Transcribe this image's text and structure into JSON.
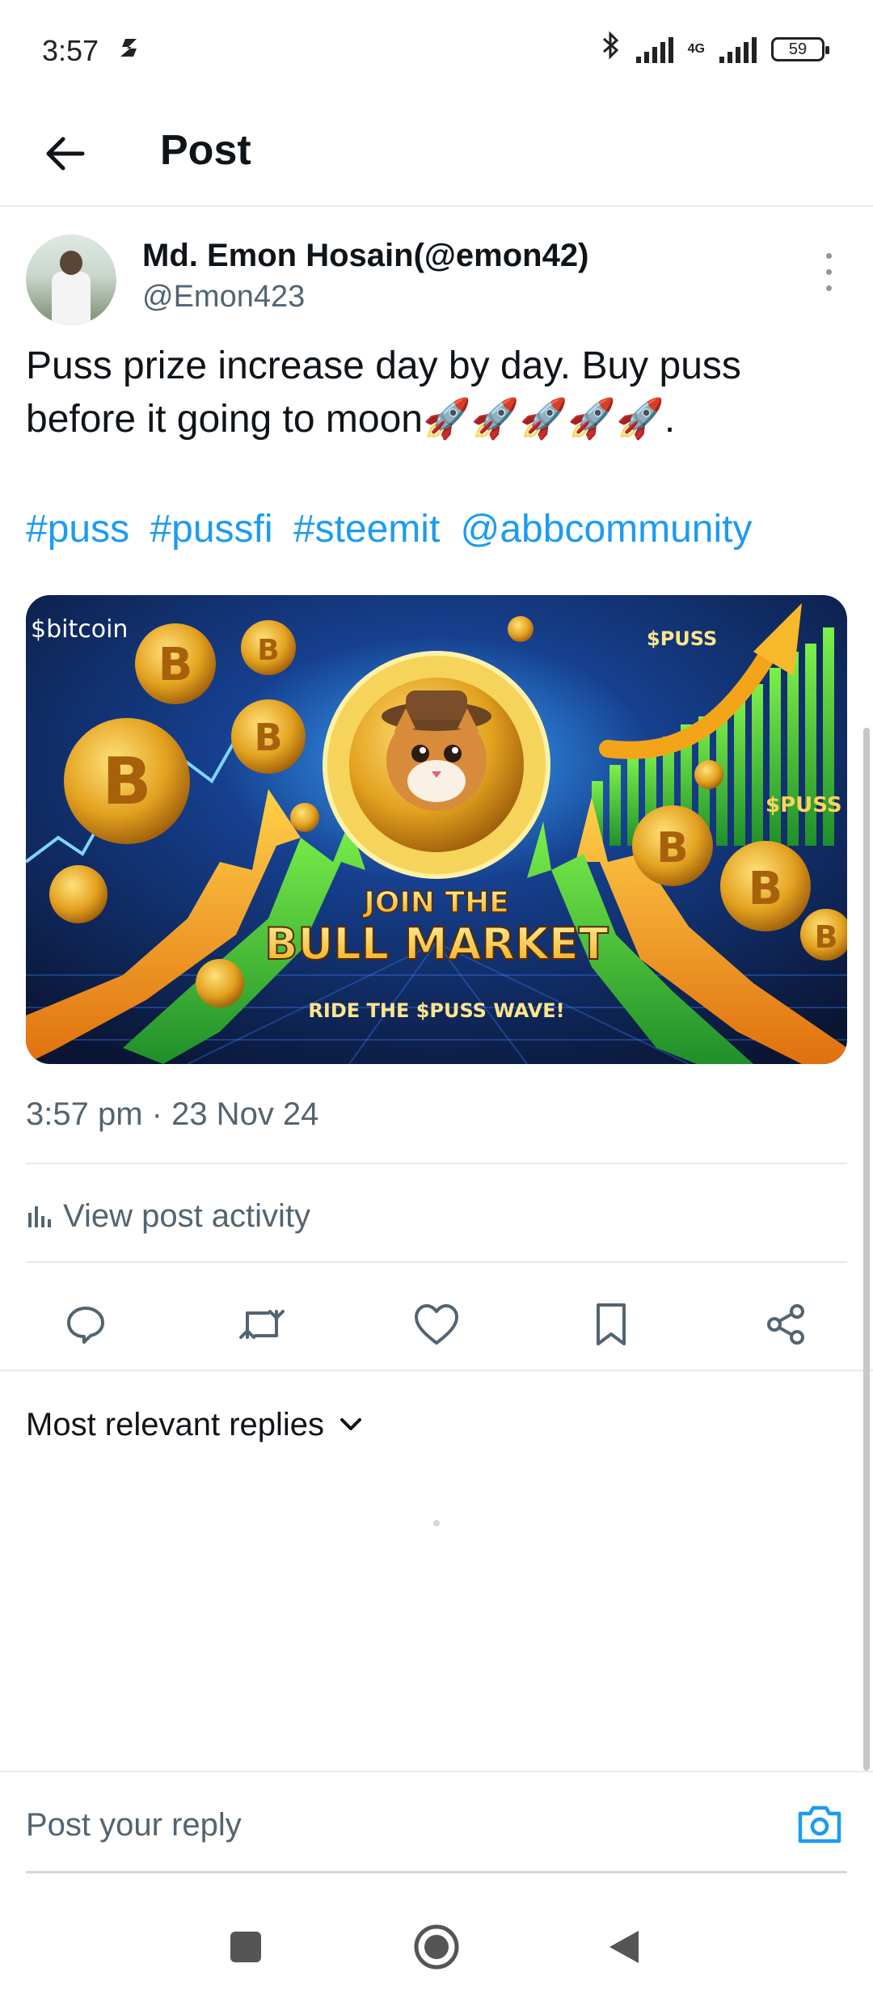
{
  "status_bar": {
    "time": "3:57",
    "app_icon": "s-notification-icon",
    "network": "4G",
    "battery": "59"
  },
  "header": {
    "title": "Post",
    "back_icon": "arrow-left-icon"
  },
  "author": {
    "display_name": "Md. Emon Hosain(@emon42)",
    "handle": "@Emon423"
  },
  "post": {
    "text": "Puss prize increase day by day. Buy puss before it going to moon🚀🚀🚀🚀🚀.",
    "hashtags": [
      "#puss",
      "#pussfi",
      "#steemit",
      "@abbcommunity"
    ],
    "image": {
      "bitcoin_label": "$bitcoin",
      "puss_label_top": "$PUSS",
      "puss_label_side": "$PUSS",
      "headline_line1": "JOIN THE",
      "headline_line2": "BULL MARKET",
      "tagline": "RIDE THE $PUSS WAVE!"
    },
    "timestamp": "3:57 pm · 23 Nov 24"
  },
  "activity": {
    "label": "View post activity",
    "icon": "bar-chart-icon"
  },
  "actions": {
    "reply_icon": "reply-icon",
    "repost_icon": "repost-icon",
    "like_icon": "heart-icon",
    "bookmark_icon": "bookmark-icon",
    "share_icon": "share-icon"
  },
  "replies": {
    "sort_label": "Most relevant replies"
  },
  "composer": {
    "placeholder": "Post your reply",
    "camera_icon": "camera-icon"
  },
  "colors": {
    "accent": "#1d9bf0",
    "text_primary": "#0f1419",
    "text_secondary": "#536471",
    "divider": "#e6e9eb"
  }
}
